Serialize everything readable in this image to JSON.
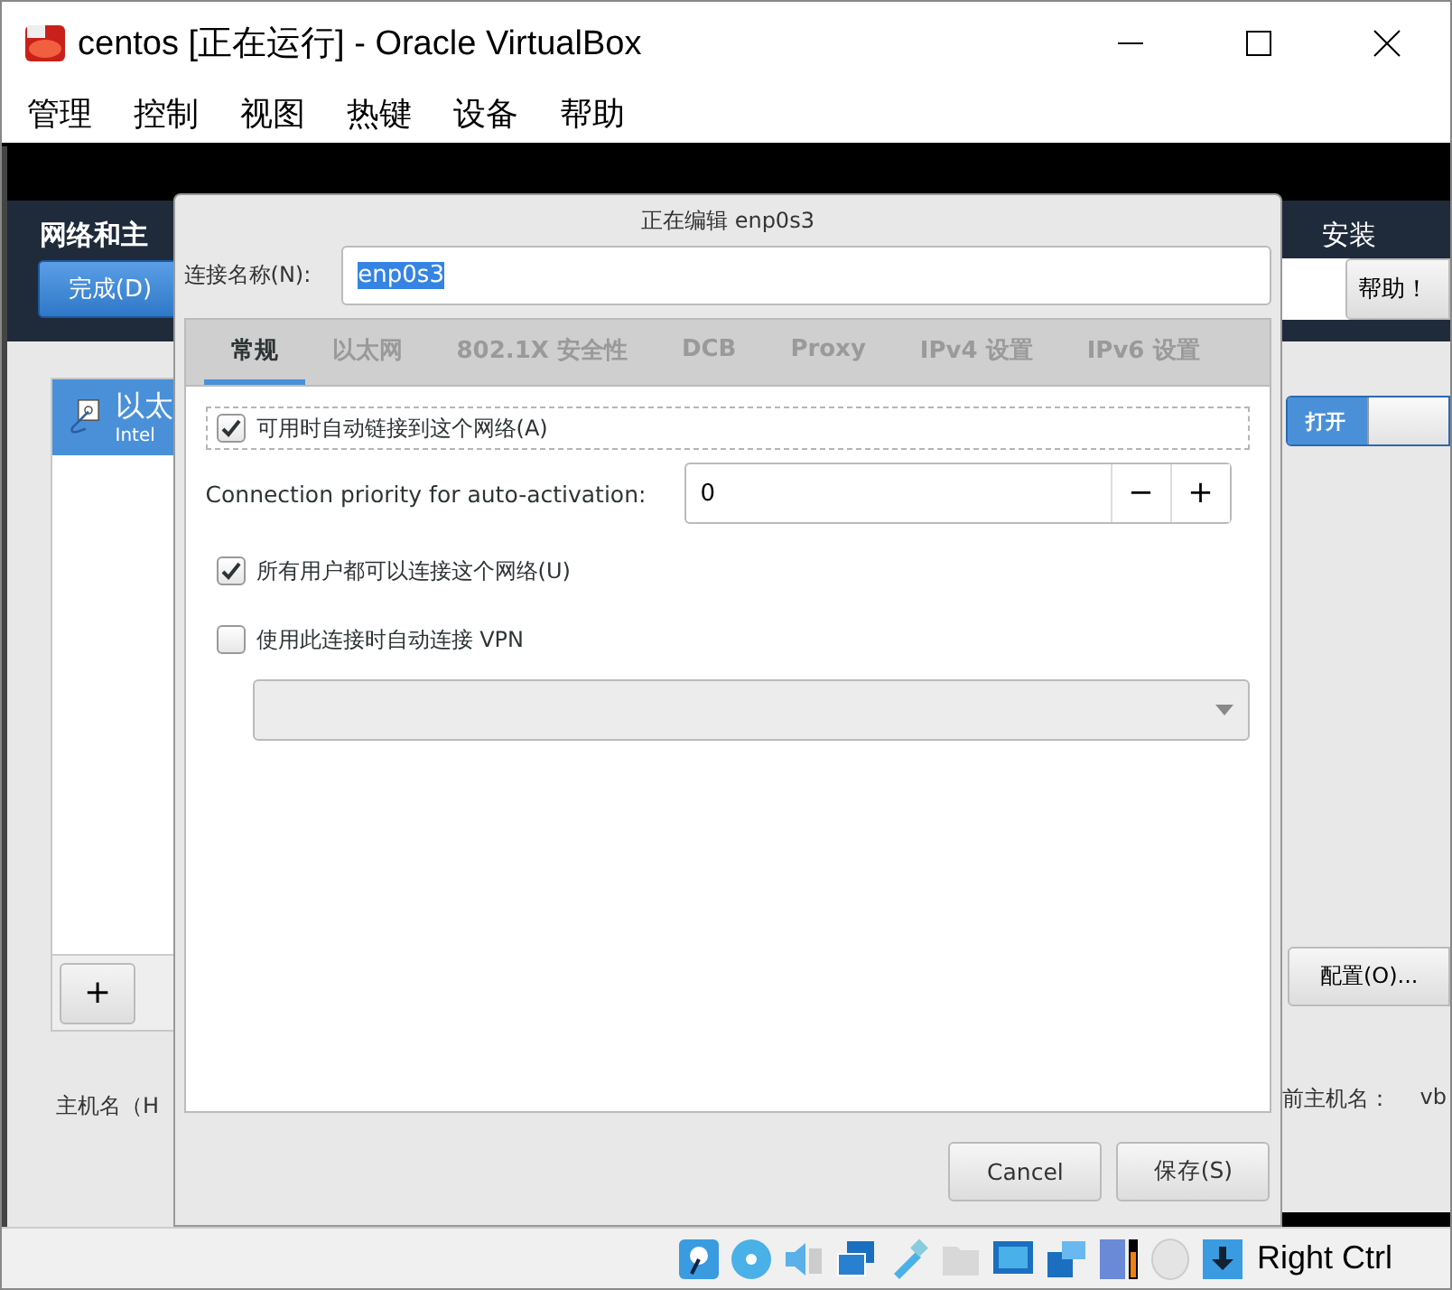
{
  "window": {
    "title": "centos [正在运行] - Oracle VirtualBox"
  },
  "menu": [
    "管理",
    "控制",
    "视图",
    "热键",
    "设备",
    "帮助"
  ],
  "installer": {
    "left": {
      "header": "网络和主",
      "done_button": "完成(D)",
      "devices": [
        {
          "name": "以太",
          "detail": "Intel",
          "selected": true
        }
      ],
      "add_button": "+",
      "hostname_label": "主机名（H"
    },
    "right": {
      "header": "安装",
      "help_button": "帮助！",
      "switch": {
        "label": "打开",
        "on": true
      },
      "configure_button": "配置(O)...",
      "current_hostname_label": "前主机名：",
      "current_hostname_value": "vb"
    }
  },
  "dialog": {
    "title": "正在编辑 enp0s3",
    "name_label": "连接名称(N):",
    "name_value": "enp0s3",
    "name_value_highlighted": true,
    "tabs": [
      {
        "label": "常规",
        "selected": true
      },
      {
        "label": "以太网",
        "selected": false
      },
      {
        "label": "802.1X 安全性",
        "selected": false
      },
      {
        "label": "DCB",
        "selected": false
      },
      {
        "label": "Proxy",
        "selected": false
      },
      {
        "label": "IPv4 设置",
        "selected": false
      },
      {
        "label": "IPv6 设置",
        "selected": false
      }
    ],
    "options": [
      {
        "kind": "checkbox",
        "label": "可用时自动链接到这个网络(A)",
        "checked": true,
        "focused": true
      },
      {
        "kind": "spin",
        "label": "Connection priority for auto-activation:",
        "value": "0",
        "minus": "−",
        "plus": "+"
      },
      {
        "kind": "checkbox",
        "label": "所有用户都可以连接这个网络(U)",
        "checked": true,
        "focused": false
      },
      {
        "kind": "checkbox",
        "label": "使用此连接时自动连接 VPN",
        "checked": false,
        "focused": false
      },
      {
        "kind": "dropdown"
      }
    ],
    "buttons": [
      "Cancel",
      "保存(S)"
    ]
  },
  "status_bar": {
    "host_key": "Right Ctrl"
  }
}
